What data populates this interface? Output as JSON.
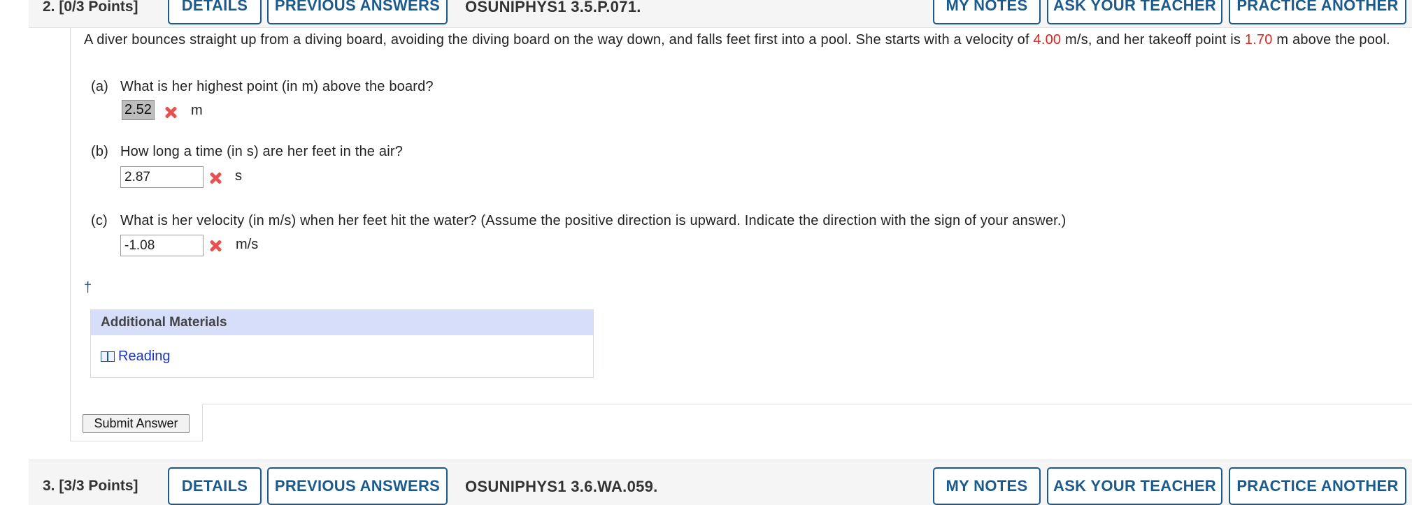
{
  "top_bar": {
    "points": "2. [0/3 Points]",
    "details": "DETAILS",
    "previous_answers": "PREVIOUS ANSWERS",
    "code": "OSUNIPHYS1 3.5.P.071.",
    "my_notes": "MY NOTES",
    "ask_teacher": "ASK YOUR TEACHER",
    "practice_another": "PRACTICE ANOTHER"
  },
  "problem": {
    "text_1": "A diver bounces straight up from a diving board, avoiding the diving board on the way down, and falls feet first into a pool. She starts with a velocity of ",
    "velocity": "4.00",
    "text_2": " m/s, and her takeoff point is ",
    "height": "1.70",
    "text_3": " m above the pool."
  },
  "parts": [
    {
      "label": "(a)",
      "question": "What is her highest point (in m) above the board?",
      "answer": "2.52",
      "unit": "m",
      "status": "incorrect"
    },
    {
      "label": "(b)",
      "question": "How long a time (in s) are her feet in the air?",
      "answer": "2.87",
      "unit": "s",
      "status": "incorrect"
    },
    {
      "label": "(c)",
      "question": "What is her velocity (in m/s) when her feet hit the water? (Assume the positive direction is upward. Indicate the direction with the sign of your answer.)",
      "answer": "-1.08",
      "unit": "m/s",
      "status": "incorrect"
    }
  ],
  "dagger": "†",
  "additional_materials": {
    "heading": "Additional Materials",
    "link_label": "Reading",
    "link_icon": "book-icon"
  },
  "submit_label": "Submit Answer",
  "bottom_bar": {
    "points": "3. [3/3 Points]",
    "details": "DETAILS",
    "previous_answers": "PREVIOUS ANSWERS",
    "code": "OSUNIPHYS1 3.6.WA.059.",
    "my_notes": "MY NOTES",
    "ask_teacher": "ASK YOUR TEACHER",
    "practice_another": "PRACTICE ANOTHER"
  },
  "colors": {
    "accent": "#1c5a8e",
    "highlight_value": "#e2231a",
    "incorrect_mark": "#e8514f",
    "materials_header": "#d6defa",
    "link": "#1a35c7"
  }
}
